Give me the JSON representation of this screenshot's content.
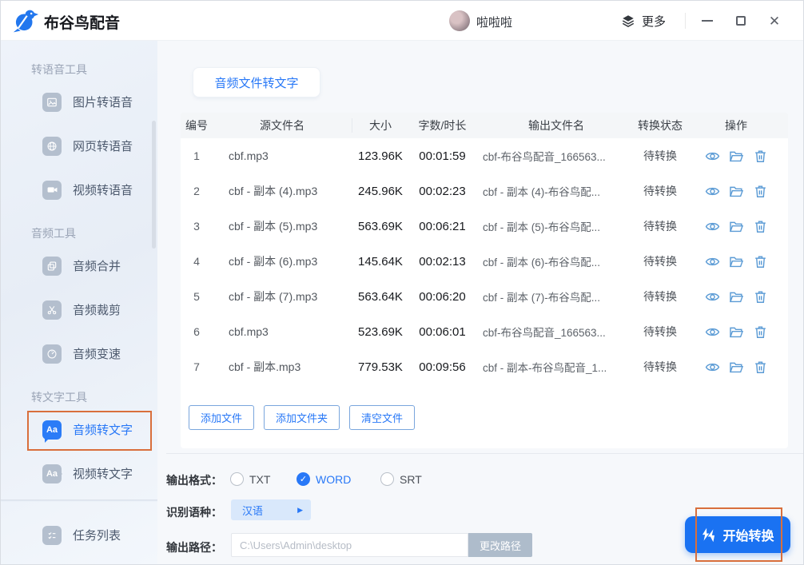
{
  "titlebar": {
    "app_title": "布谷鸟配音",
    "username": "啦啦啦",
    "more_label": "更多"
  },
  "sidebar": {
    "sections": [
      {
        "label": "转语音工具",
        "items": [
          {
            "label": "图片转语音",
            "icon": "picture-icon"
          },
          {
            "label": "网页转语音",
            "icon": "globe-icon"
          },
          {
            "label": "视频转语音",
            "icon": "video-camera-icon"
          }
        ]
      },
      {
        "label": "音频工具",
        "items": [
          {
            "label": "音频合并",
            "icon": "merge-icon"
          },
          {
            "label": "音频裁剪",
            "icon": "scissors-icon"
          },
          {
            "label": "音频变速",
            "icon": "speed-icon"
          }
        ]
      },
      {
        "label": "转文字工具",
        "items": [
          {
            "label": "音频转文字",
            "icon": "audio-text-bubble-icon",
            "selected": true
          },
          {
            "label": "视频转文字",
            "icon": "video-text-icon"
          }
        ]
      }
    ],
    "task_list_label": "任务列表",
    "aa_glyph": "Aa"
  },
  "main": {
    "tab_label": "音频文件转文字",
    "table": {
      "columns": [
        "编号",
        "源文件名",
        "大小",
        "字数/时长",
        "输出文件名",
        "转换状态",
        "操作"
      ],
      "rows": [
        {
          "id": "1",
          "source": "cbf.mp3",
          "size": "123.96K",
          "duration": "00:01:59",
          "output": "cbf-布谷鸟配音_166563...",
          "status": "待转换"
        },
        {
          "id": "2",
          "source": "cbf - 副本 (4).mp3",
          "size": "245.96K",
          "duration": "00:02:23",
          "output": "cbf - 副本 (4)-布谷鸟配...",
          "status": "待转换"
        },
        {
          "id": "3",
          "source": "cbf - 副本 (5).mp3",
          "size": "563.69K",
          "duration": "00:06:21",
          "output": "cbf - 副本 (5)-布谷鸟配...",
          "status": "待转换"
        },
        {
          "id": "4",
          "source": "cbf - 副本 (6).mp3",
          "size": "145.64K",
          "duration": "00:02:13",
          "output": "cbf - 副本 (6)-布谷鸟配...",
          "status": "待转换"
        },
        {
          "id": "5",
          "source": "cbf - 副本 (7).mp3",
          "size": "563.64K",
          "duration": "00:06:20",
          "output": "cbf - 副本 (7)-布谷鸟配...",
          "status": "待转换"
        },
        {
          "id": "6",
          "source": "cbf.mp3",
          "size": "523.69K",
          "duration": "00:06:01",
          "output": "cbf-布谷鸟配音_166563...",
          "status": "待转换"
        },
        {
          "id": "7",
          "source": "cbf - 副本.mp3",
          "size": "779.53K",
          "duration": "00:09:56",
          "output": "cbf - 副本-布谷鸟配音_1...",
          "status": "待转换"
        }
      ]
    },
    "buttons": {
      "add_file": "添加文件",
      "add_folder": "添加文件夹",
      "clear": "清空文件"
    },
    "output_format": {
      "label": "输出格式：",
      "options": [
        {
          "label": "TXT",
          "checked": false
        },
        {
          "label": "WORD",
          "checked": true
        },
        {
          "label": "SRT",
          "checked": false
        }
      ]
    },
    "language": {
      "label": "识别语种：",
      "value": "汉语"
    },
    "output_path": {
      "label": "输出路径：",
      "value": "C:\\Users\\Admin\\desktop",
      "change_label": "更改路径"
    },
    "start_label": "开始转换"
  },
  "icons": {
    "bird-logo": "blue cuckoo bird",
    "layers-icon": "stacked layers",
    "minimize-icon": "—",
    "maximize-icon": "□",
    "close-icon": "✕",
    "picture-icon": "image",
    "globe-icon": "globe",
    "video-camera-icon": "video camera",
    "merge-icon": "overlapping squares",
    "scissors-icon": "scissors",
    "speed-icon": "gauge",
    "audio-text-bubble-icon": "Aa speech bubble",
    "video-text-icon": "Aa video",
    "task-list-icon": "checklist",
    "eye-icon": "eye",
    "folder-open-icon": "open folder",
    "trash-icon": "trash bin",
    "arrow-right-icon": "▶",
    "lightning-icon": "double lightning bolt",
    "radio-check-icon": "✓"
  },
  "colors": {
    "accent": "#2878f7",
    "start_button": "#1a72f2",
    "annotation": "#d96f3c",
    "action_icon": "#5b9bd5",
    "sidebar_icon": "#b4bfce"
  }
}
